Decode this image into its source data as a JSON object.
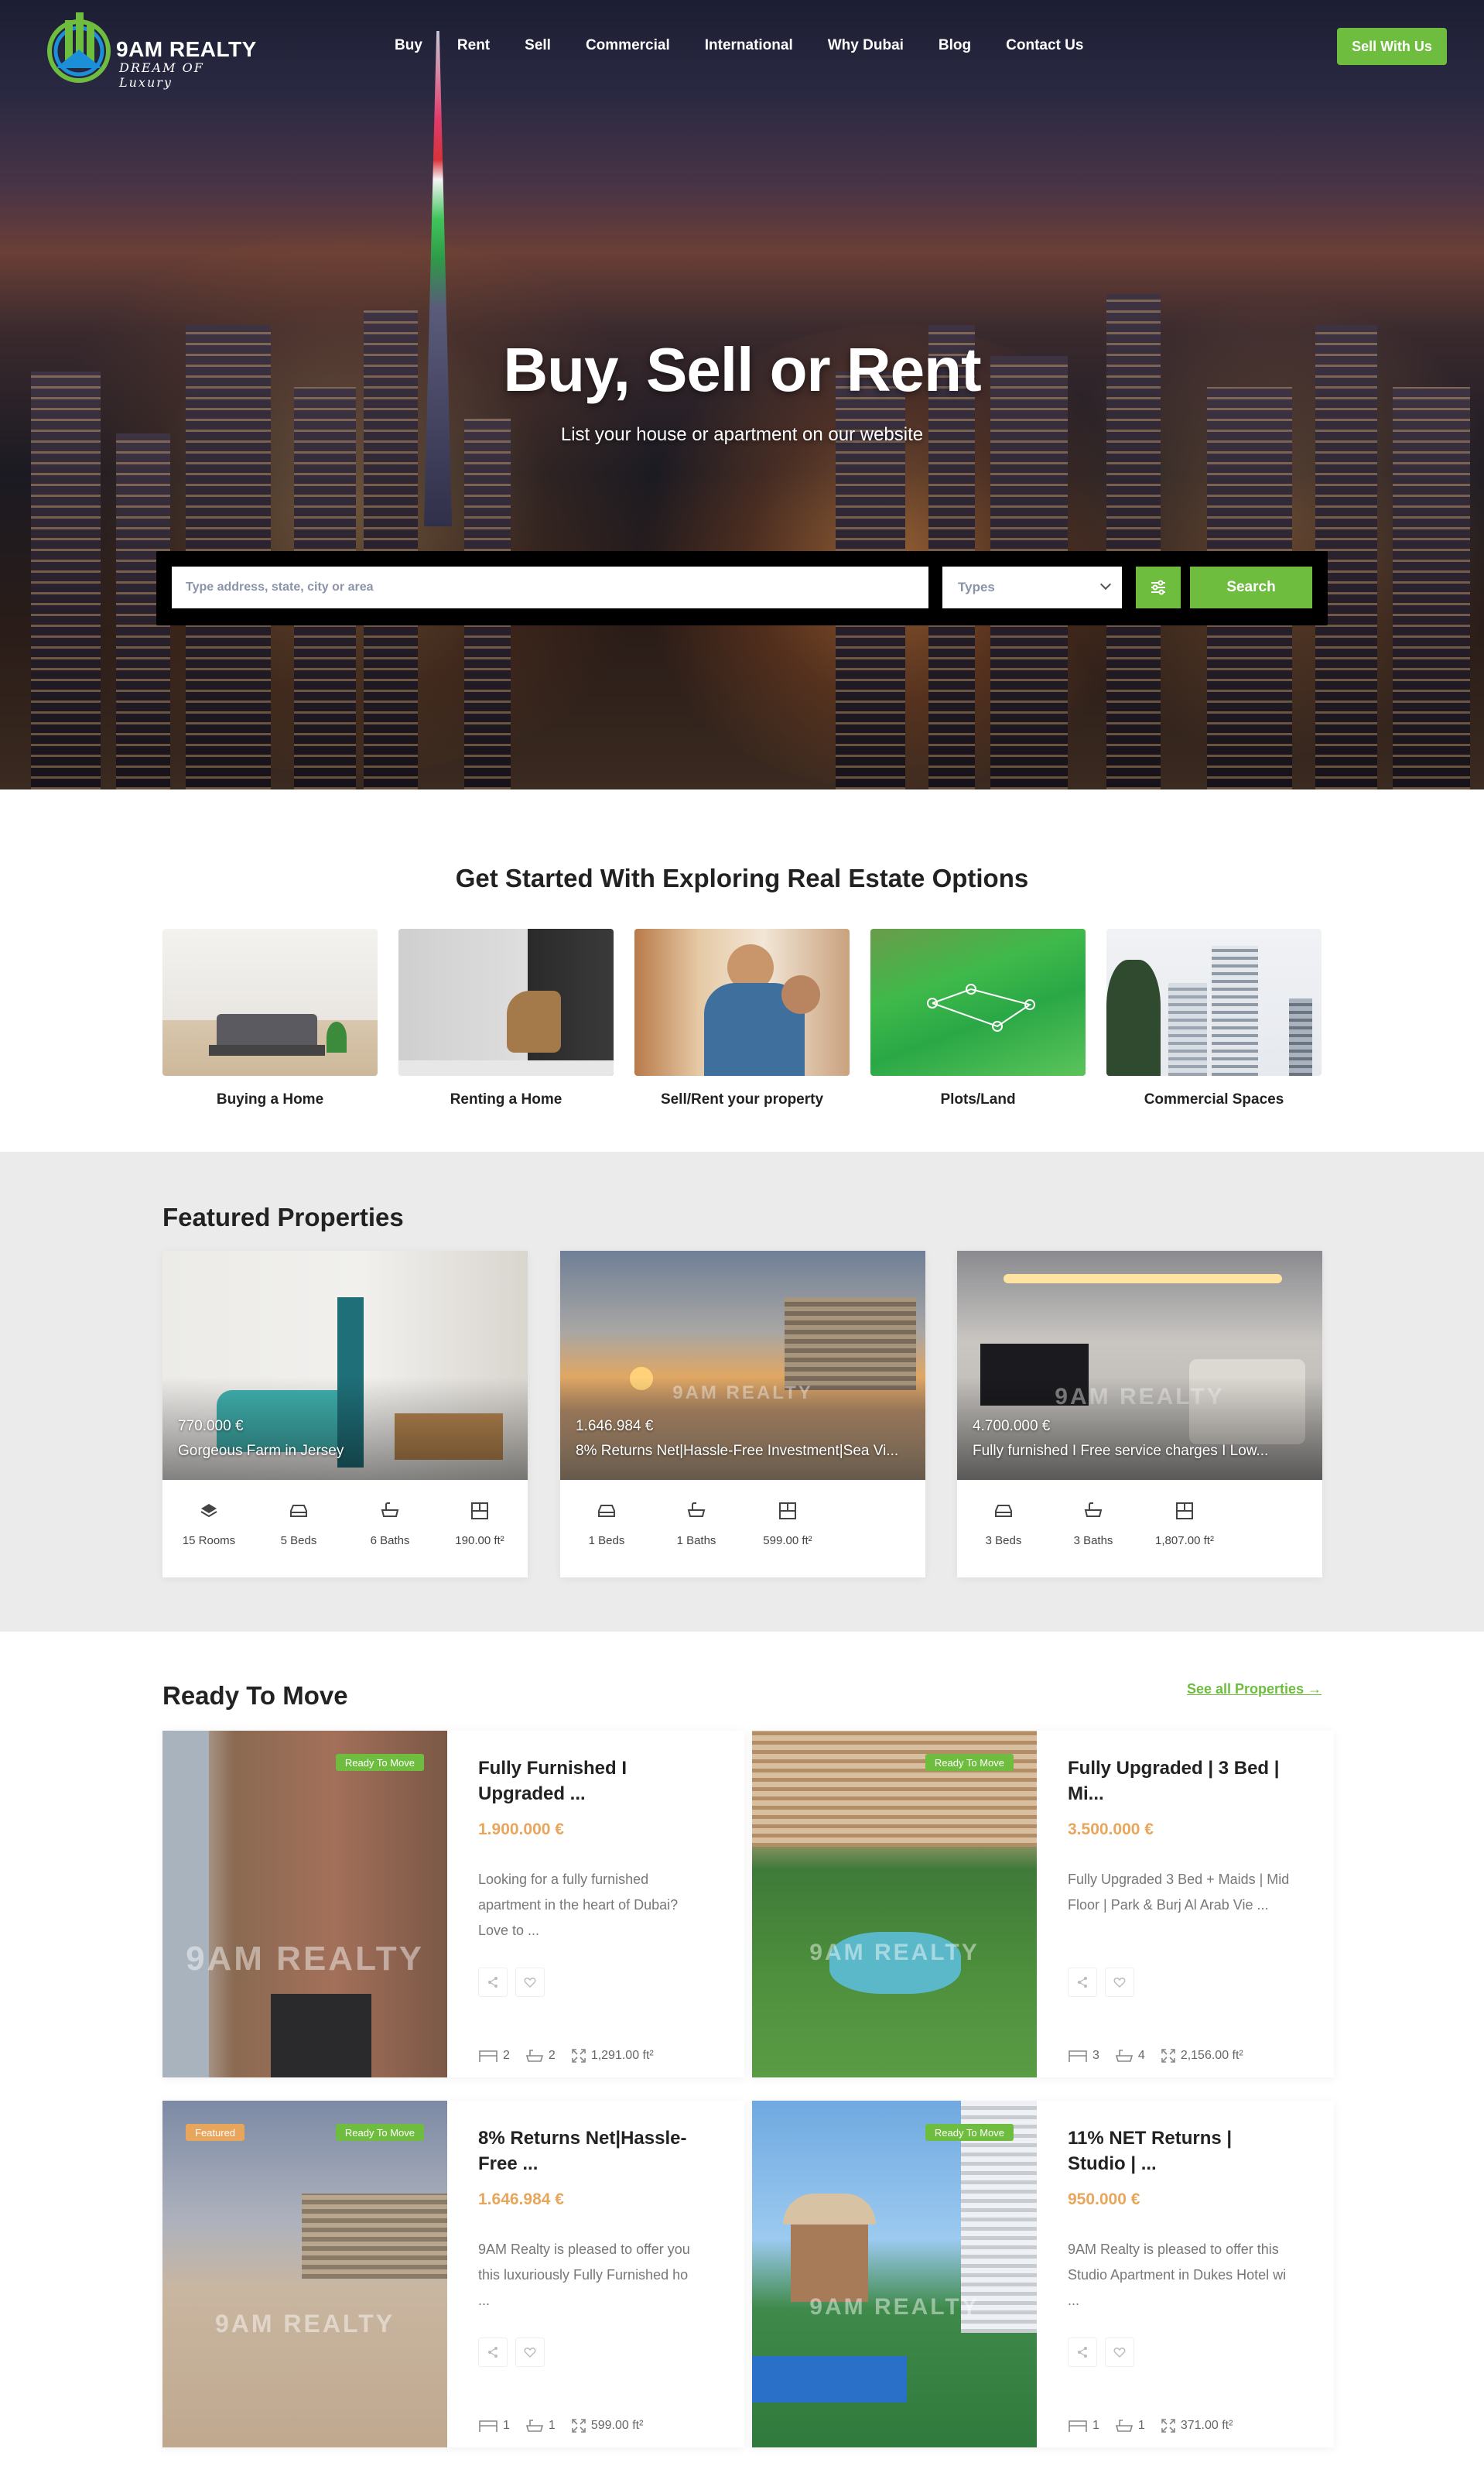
{
  "brand": {
    "name": "9AM REALTY",
    "tagline": "DREAM OF Luxury"
  },
  "nav": {
    "items": [
      {
        "label": "Buy"
      },
      {
        "label": "Rent"
      },
      {
        "label": "Sell"
      },
      {
        "label": "Commercial"
      },
      {
        "label": "International"
      },
      {
        "label": "Why Dubai"
      },
      {
        "label": "Blog"
      },
      {
        "label": "Contact Us"
      }
    ],
    "cta": "Sell With Us"
  },
  "hero": {
    "title": "Buy, Sell or Rent",
    "subtitle": "List your house or apartment on our website",
    "search": {
      "placeholder": "Type address, state, city or area",
      "types_label": "Types",
      "button": "Search"
    }
  },
  "explore": {
    "title": "Get Started With Exploring Real Estate Options",
    "items": [
      {
        "label": "Buying a Home"
      },
      {
        "label": "Renting a Home"
      },
      {
        "label": "Sell/Rent your property"
      },
      {
        "label": "Plots/Land"
      },
      {
        "label": "Commercial Spaces"
      }
    ]
  },
  "featured": {
    "title": "Featured Properties",
    "cards": [
      {
        "price": "770.000 €",
        "title": "Gorgeous Farm in Jersey",
        "features": [
          {
            "icon": "rooms-icon",
            "text": "15 Rooms"
          },
          {
            "icon": "bed-icon",
            "text": "5 Beds"
          },
          {
            "icon": "bath-icon",
            "text": "6 Baths"
          },
          {
            "icon": "area-icon",
            "text": "190.00 ft²"
          }
        ]
      },
      {
        "price": "1.646.984 €",
        "title": "8% Returns Net|Hassle-Free Investment|Sea Vi...",
        "features": [
          {
            "icon": "bed-icon",
            "text": "1 Beds"
          },
          {
            "icon": "bath-icon",
            "text": "1 Baths"
          },
          {
            "icon": "area-icon",
            "text": "599.00 ft²"
          }
        ]
      },
      {
        "price": "4.700.000 €",
        "title": "Fully furnished I Free service charges I Low...",
        "features": [
          {
            "icon": "bed-icon",
            "text": "3 Beds"
          },
          {
            "icon": "bath-icon",
            "text": "3 Baths"
          },
          {
            "icon": "area-icon",
            "text": "1,807.00 ft²"
          }
        ]
      }
    ]
  },
  "ready": {
    "title": "Ready To Move",
    "see_all": "See all Properties →",
    "cards": [
      {
        "badges": [
          "Ready To Move"
        ],
        "title": "Fully Furnished I Upgraded ...",
        "price": "1.900.000 €",
        "desc": "Looking for a fully furnished apartment in the heart of Dubai? Love to ...",
        "beds": "2",
        "baths": "2",
        "area": "1,291.00 ft²"
      },
      {
        "badges": [
          "Ready To Move"
        ],
        "title": "Fully Upgraded | 3 Bed | Mi...",
        "price": "3.500.000 €",
        "desc": "Fully Upgraded 3 Bed + Maids | Mid Floor | Park & Burj Al Arab Vie ...",
        "beds": "3",
        "baths": "4",
        "area": "2,156.00 ft²"
      },
      {
        "badges": [
          "Featured",
          "Ready To Move"
        ],
        "title": "8% Returns Net|Hassle-Free ...",
        "price": "1.646.984 €",
        "desc": "9AM Realty is pleased to offer you this luxuriously Fully Furnished ho ...",
        "beds": "1",
        "baths": "1",
        "area": "599.00 ft²"
      },
      {
        "badges": [
          "Ready To Move"
        ],
        "title": "11% NET Returns | Studio | ...",
        "price": "950.000 €",
        "desc": "9AM Realty is pleased to offer this Studio Apartment in Dukes Hotel wi ...",
        "beds": "1",
        "baths": "1",
        "area": "371.00 ft²"
      }
    ],
    "watermark": "9AM REALTY"
  },
  "colors": {
    "accent": "#6ebd3f",
    "price": "#e8a65c",
    "section_bg": "#ebebeb"
  }
}
